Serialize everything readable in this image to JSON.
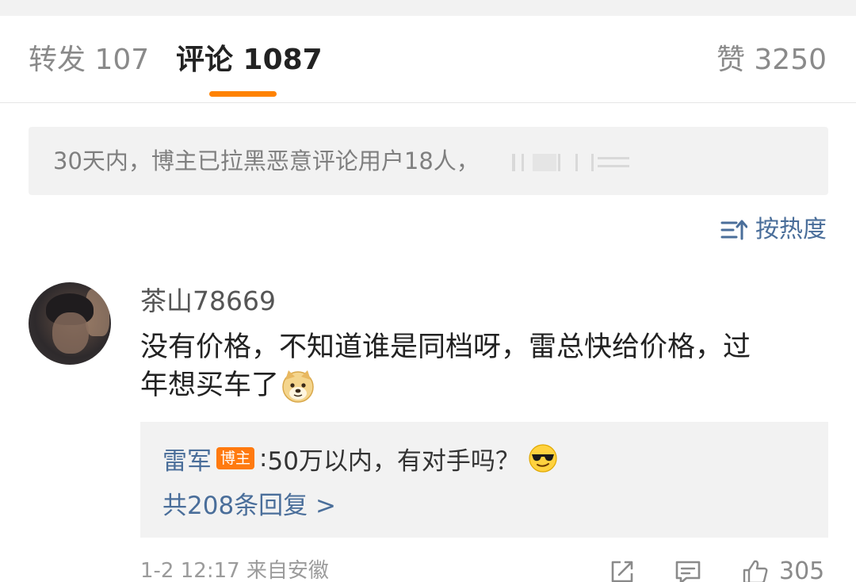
{
  "tabs": {
    "repost": "转发 107",
    "comments": "评论 1087",
    "likes": "赞 3250",
    "active": "comments",
    "accent_color": "#ff8200"
  },
  "notice": {
    "text": "30天内，博主已拉黑恶意评论用户18人，"
  },
  "sort": {
    "label": "按热度",
    "icon": "sort-icon"
  },
  "comment": {
    "username": "茶山78669",
    "avatar_icon": "avatar",
    "text_line1": "没有价格，不知道谁是同档呀，雷总快给价格，过",
    "text_line2": "年想买车了",
    "emoji": "doge-emoji"
  },
  "reply": {
    "author": "雷军",
    "badge": "博主",
    "colon": ":",
    "text": "50万以内，有对手吗？",
    "emoji": "cool-sunglasses-emoji",
    "more": "共208条回复 >"
  },
  "footer": {
    "meta": "1-2 12:17  来自安徽",
    "likes": "305",
    "icons": [
      "share-icon",
      "comment-icon",
      "like-icon"
    ]
  },
  "colors": {
    "link_blue": "#4a6e9a",
    "badge_orange": "#ff7a0f",
    "panel_gray": "#f2f2f2"
  }
}
